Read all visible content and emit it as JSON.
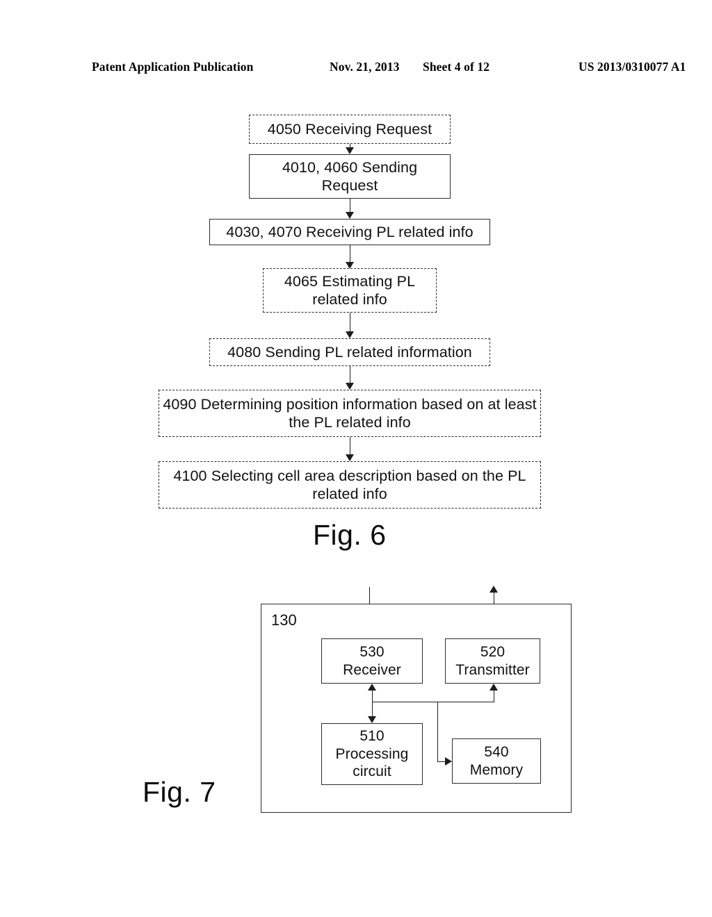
{
  "header": {
    "publication": "Patent Application Publication",
    "date": "Nov. 21, 2013",
    "sheet": "Sheet 4 of 12",
    "patent_number": "US 2013/0310077 A1"
  },
  "figures": [
    {
      "caption": "Fig. 6",
      "type": "flowchart",
      "steps": [
        {
          "id": "4050",
          "label": "4050 Receiving Request",
          "style": "dashed"
        },
        {
          "id": "4010-4060",
          "label": "4010, 4060 Sending Request",
          "style": "solid"
        },
        {
          "id": "4030-4070",
          "label": "4030, 4070 Receiving PL related info",
          "style": "solid"
        },
        {
          "id": "4065",
          "label": "4065 Estimating PL related info",
          "style": "dashed"
        },
        {
          "id": "4080",
          "label": "4080 Sending PL related information",
          "style": "dashed"
        },
        {
          "id": "4090",
          "label": "4090 Determining position information based on at least the PL related info",
          "style": "dashed"
        },
        {
          "id": "4100",
          "label": "4100 Selecting cell area description based on the PL related info",
          "style": "dashed"
        }
      ]
    },
    {
      "caption": "Fig. 7",
      "type": "block-diagram",
      "container_label": "130",
      "blocks": [
        {
          "id": "530",
          "label": "530\nReceiver"
        },
        {
          "id": "520",
          "label": "520\nTransmitter"
        },
        {
          "id": "510",
          "label": "510\nProcessing circuit"
        },
        {
          "id": "540",
          "label": "540\nMemory"
        }
      ],
      "block_text": {
        "receiver_num": "530",
        "receiver_name": "Receiver",
        "transmitter_num": "520",
        "transmitter_name": "Transmitter",
        "processing_num": "510",
        "processing_name_line1": "Processing",
        "processing_name_line2": "circuit",
        "memory_num": "540",
        "memory_name": "Memory"
      }
    }
  ],
  "flow_labels": {
    "s4050": "4050 Receiving Request",
    "s4010_l1": "4010, 4060 Sending",
    "s4010_l2": "Request",
    "s4030": "4030, 4070 Receiving PL related info",
    "s4065_l1": "4065 Estimating PL",
    "s4065_l2": "related info",
    "s4080": "4080 Sending PL related information",
    "s4090_l1": "4090 Determining position information based on at least",
    "s4090_l2": "the PL related info",
    "s4100_l1": "4100 Selecting cell area description based on the PL",
    "s4100_l2": "related info"
  },
  "captions": {
    "fig6": "Fig. 6",
    "fig7": "Fig. 7"
  },
  "colors": {
    "ink": "#111111",
    "line": "#1d1d1d",
    "background": "#ffffff"
  }
}
